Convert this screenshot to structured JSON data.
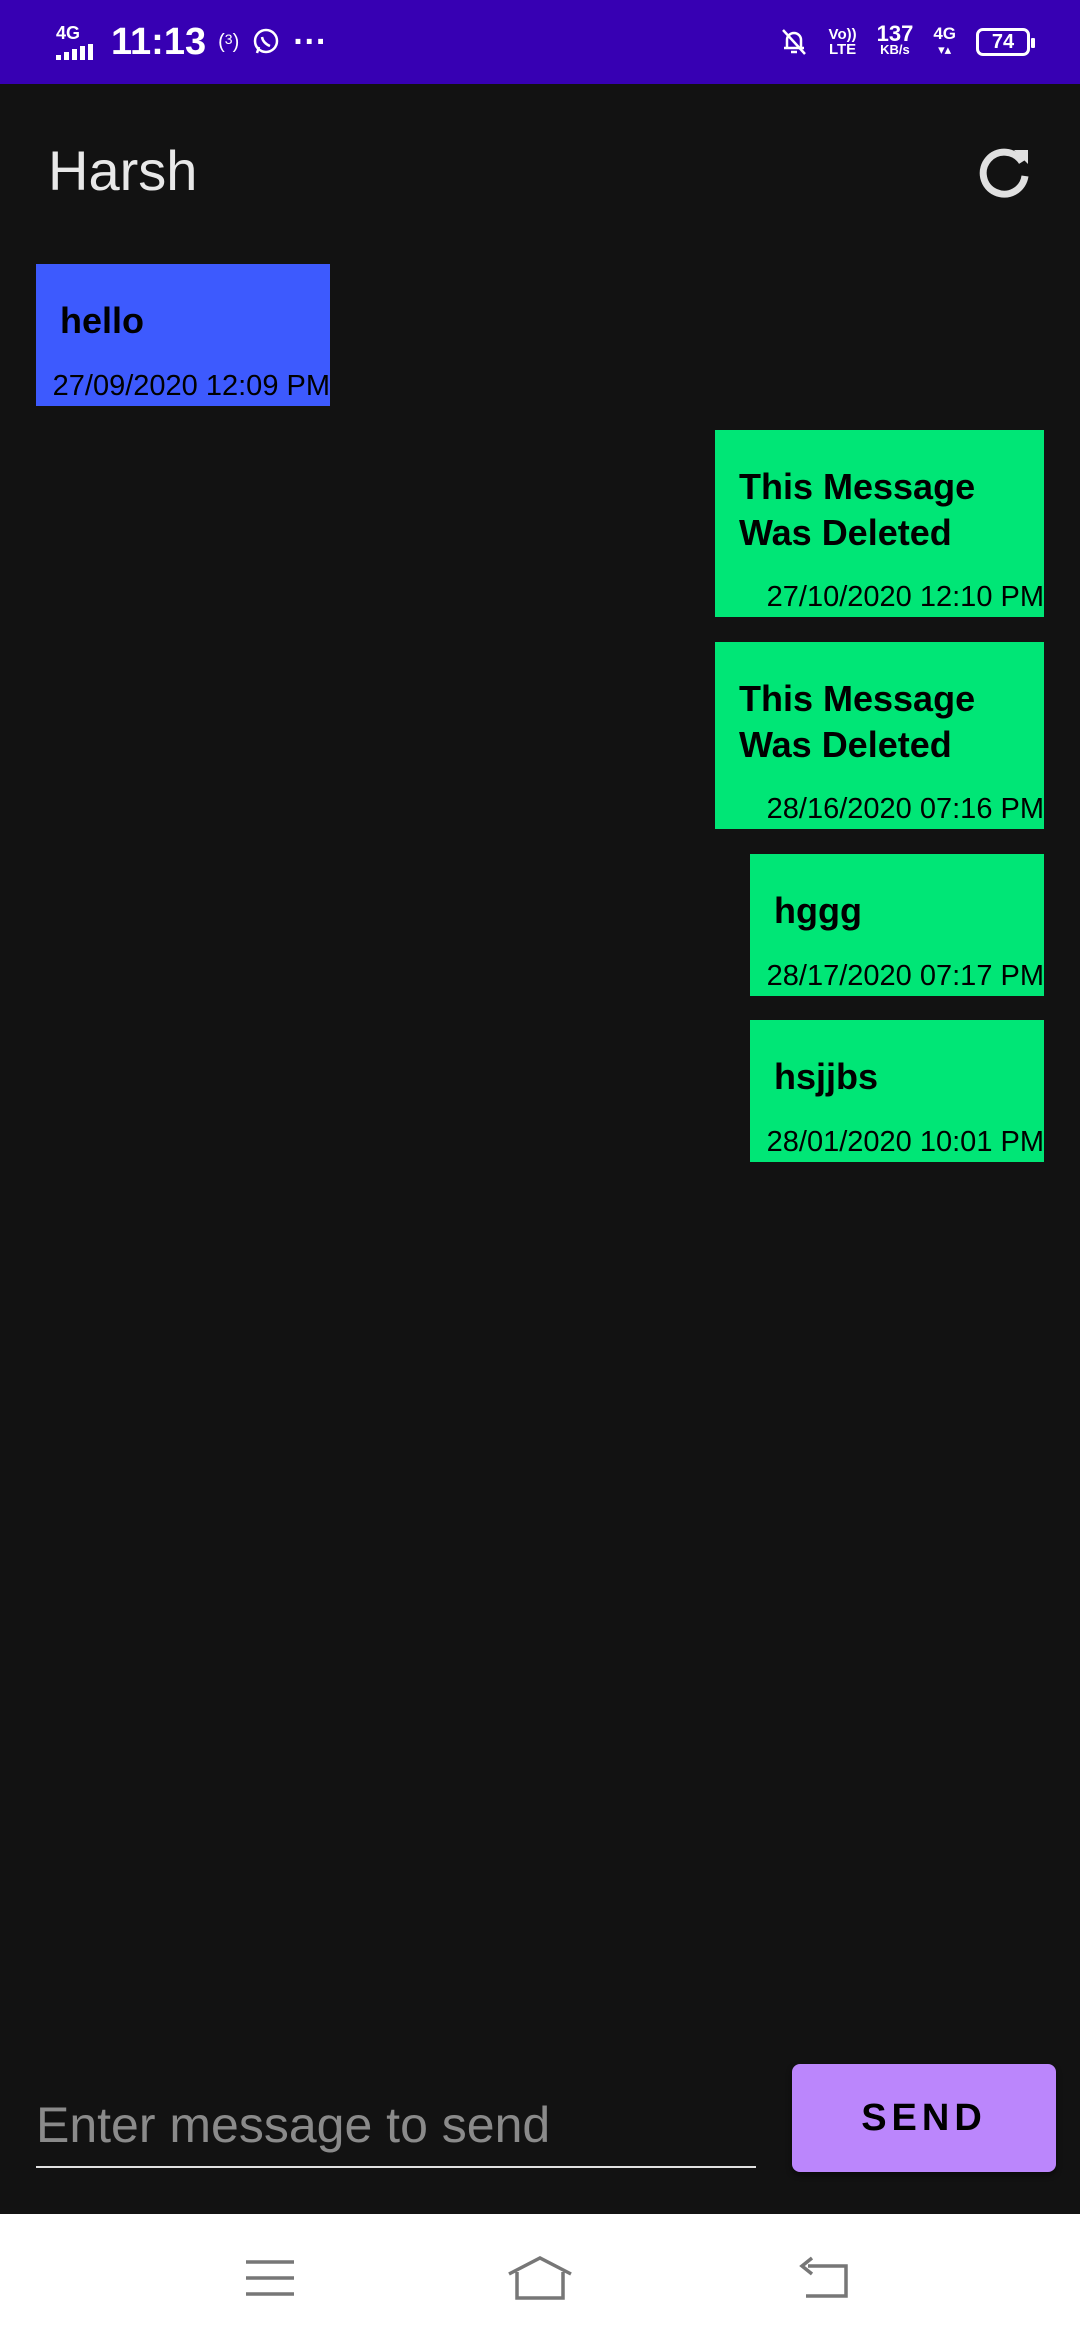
{
  "status_bar": {
    "network_type": "4G",
    "time": "11:13",
    "hotspot_count": "3",
    "more": "···",
    "volte_top": "Vo))",
    "volte_bottom": "LTE",
    "speed_value": "137",
    "speed_unit": "KB/s",
    "data_type": "4G",
    "battery_level": "74"
  },
  "header": {
    "title": "Harsh"
  },
  "messages": [
    {
      "direction": "received",
      "text": "hello",
      "time": "27/09/2020 12:09 PM"
    },
    {
      "direction": "sent",
      "text": "This Message Was Deleted",
      "time": "27/10/2020 12:10 PM"
    },
    {
      "direction": "sent",
      "text": "This Message Was Deleted",
      "time": "28/16/2020 07:16 PM"
    },
    {
      "direction": "sent",
      "text": "hggg",
      "time": "28/17/2020 07:17 PM"
    },
    {
      "direction": "sent",
      "text": "hsjjbs",
      "time": "28/01/2020 10:01 PM"
    }
  ],
  "composer": {
    "placeholder": "Enter message to send",
    "value": "",
    "send_label": "SEND"
  },
  "colors": {
    "status_bar": "#3700b3",
    "received": "#3d5afe",
    "sent": "#00e676",
    "send_button": "#bb86fc",
    "background": "#121212"
  },
  "nav_icons": [
    "menu-icon",
    "home-icon",
    "back-icon"
  ]
}
